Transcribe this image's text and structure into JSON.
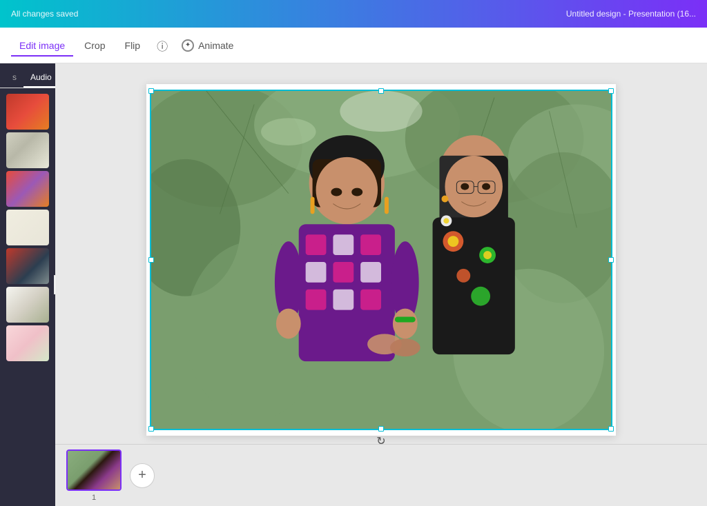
{
  "topBar": {
    "leftText": "All changes saved",
    "rightText": "Untitled design - Presentation (16..."
  },
  "toolbar": {
    "tabs": [
      {
        "id": "edit-image",
        "label": "Edit image",
        "active": true
      },
      {
        "id": "crop",
        "label": "Crop",
        "active": false
      },
      {
        "id": "flip",
        "label": "Flip",
        "active": false
      },
      {
        "id": "animate",
        "label": "Animate",
        "active": false
      }
    ],
    "infoIcon": "ⓘ",
    "animateIconSymbol": "◎"
  },
  "sidebar": {
    "tabs": [
      {
        "label": "s",
        "active": false
      },
      {
        "label": "Audio",
        "active": false
      }
    ],
    "collapseIcon": "‹"
  },
  "canvas": {
    "slideNumber": "1",
    "addSlideIcon": "+",
    "rotateIcon": "↻",
    "chevronIcon": "˅"
  },
  "filmstrip": {
    "slideNumber": "1",
    "addButtonLabel": "+"
  }
}
